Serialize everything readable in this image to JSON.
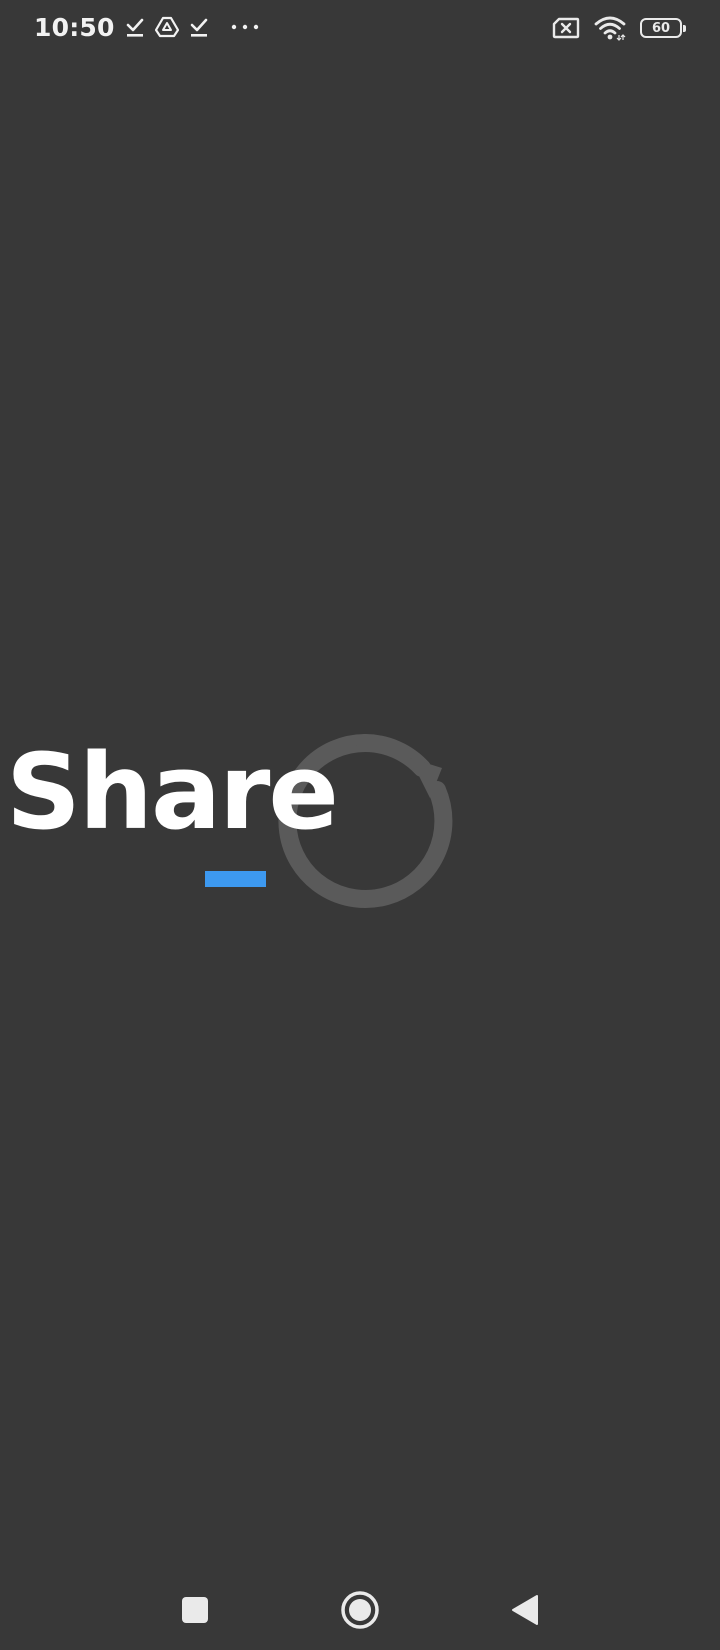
{
  "status_bar": {
    "time": "10:50",
    "left_icons": [
      "download-done-icon",
      "drive-icon",
      "download-done-icon",
      "more-dots-icon"
    ],
    "right_icons": [
      "sim-error-icon",
      "wifi-icon",
      "battery-icon"
    ],
    "battery_level": "60"
  },
  "splash": {
    "logo_text": "Share",
    "accent_color": "#3d99f0",
    "ring_color": "#5a5a5a"
  },
  "nav_bar": {
    "buttons": [
      "recents-button",
      "home-button",
      "back-button"
    ]
  },
  "colors": {
    "background": "#383838",
    "foreground": "#ffffff"
  }
}
